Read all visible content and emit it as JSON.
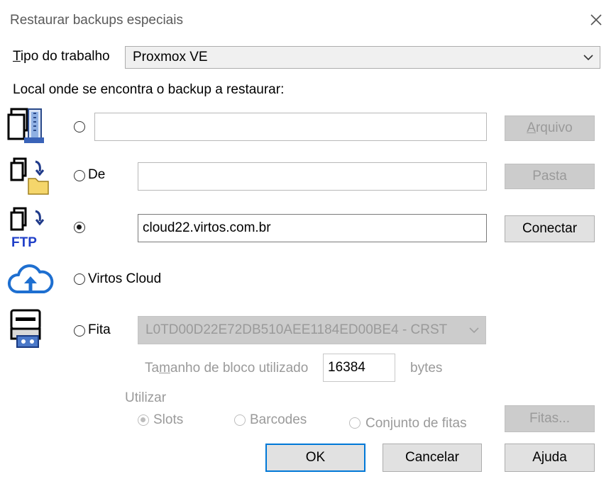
{
  "window": {
    "title": "Restaurar backups especiais"
  },
  "job_type": {
    "label": "Tipo do trabalho",
    "value": "Proxmox VE"
  },
  "location_label": "Local onde se encontra o backup a restaurar:",
  "options": {
    "file": {
      "value": "",
      "button": "Arquivo"
    },
    "folder": {
      "label": "De",
      "value": "",
      "button": "Pasta"
    },
    "ftp": {
      "value": "cloud22.virtos.com.br",
      "button": "Conectar",
      "icon_text": "FTP"
    },
    "cloud": {
      "label": "Virtos Cloud"
    },
    "tape": {
      "label": "Fita",
      "device": "L0TD00D22E72DB510AEE1184ED00BE4 - CRST",
      "block_size_label": "Tamanho de bloco utilizado",
      "block_size_value": "16384",
      "block_size_unit": "bytes",
      "use_label": "Utilizar",
      "use_options": [
        "Slots",
        "Barcodes",
        "Conjunto de fitas"
      ],
      "tapes_button": "Fitas..."
    }
  },
  "footer": {
    "ok": "OK",
    "cancel": "Cancelar",
    "help": "Ajuda"
  },
  "icons": [
    "zip-archive-icon",
    "copy-to-folder-icon",
    "ftp-icon",
    "cloud-upload-icon",
    "tape-drive-icon",
    "close-icon",
    "chevron-down-icon"
  ]
}
